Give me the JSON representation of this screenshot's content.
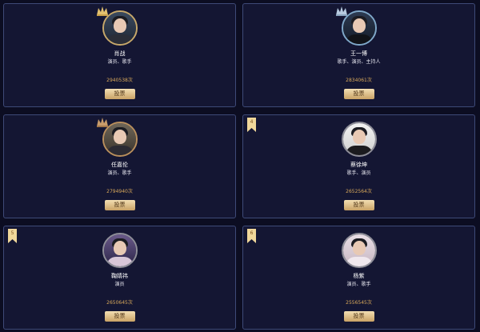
{
  "cards": [
    {
      "name": "肖战",
      "roles": "演员、歌手",
      "votes": "2940538次",
      "button": "投票",
      "rank": "",
      "crown_color": "#e3c16f",
      "ring": "gold"
    },
    {
      "name": "王一博",
      "roles": "歌手、演员、主持人",
      "votes": "2834061次",
      "button": "投票",
      "rank": "",
      "crown_color": "#b7cbe0",
      "ring": "blue"
    },
    {
      "name": "任嘉伦",
      "roles": "演员、歌手",
      "votes": "2794940次",
      "button": "投票",
      "rank": "",
      "crown_color": "#c99c6b",
      "ring": "brown"
    },
    {
      "name": "蔡徐坤",
      "roles": "歌手、演员",
      "votes": "2652564次",
      "button": "投票",
      "rank": "4",
      "crown_color": "",
      "ring": "plain"
    },
    {
      "name": "鞠婧祎",
      "roles": "演员",
      "votes": "2650645次",
      "button": "投票",
      "rank": "5",
      "crown_color": "",
      "ring": "plain"
    },
    {
      "name": "杨紫",
      "roles": "演员、歌手",
      "votes": "2556545次",
      "button": "投票",
      "rank": "6",
      "crown_color": "",
      "ring": "plain"
    }
  ]
}
